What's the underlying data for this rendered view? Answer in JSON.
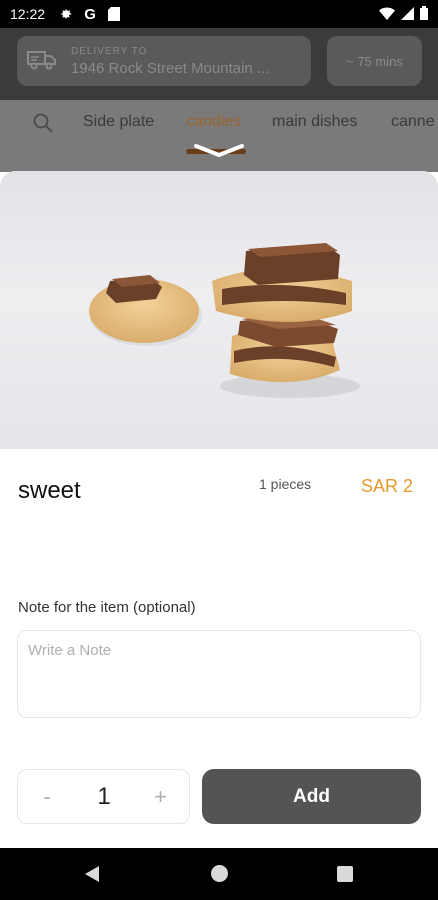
{
  "status_bar": {
    "time": "12:22",
    "icons": [
      "settings-icon",
      "google-icon",
      "sim-card-icon",
      "wifi-icon",
      "signal-icon",
      "battery-icon"
    ]
  },
  "header": {
    "delivery_label": "DELIVERY TO",
    "delivery_address": "1946 Rock Street Mountain ...",
    "eta": "~ 75 mins"
  },
  "tabs": {
    "items": [
      "Side plate",
      "candies",
      "main dishes",
      "canne"
    ],
    "active": "candies"
  },
  "item": {
    "name": "sweet",
    "pieces": "1 pieces",
    "price": "SAR 2"
  },
  "note": {
    "label": "Note for the item (optional)",
    "placeholder": "Write a Note"
  },
  "stepper": {
    "minus": "-",
    "quantity": "1",
    "plus": "+"
  },
  "actions": {
    "add_label": "Add"
  },
  "colors": {
    "accent": "#e59a2b",
    "button": "#545454",
    "overlay": "#3b3b3b"
  }
}
